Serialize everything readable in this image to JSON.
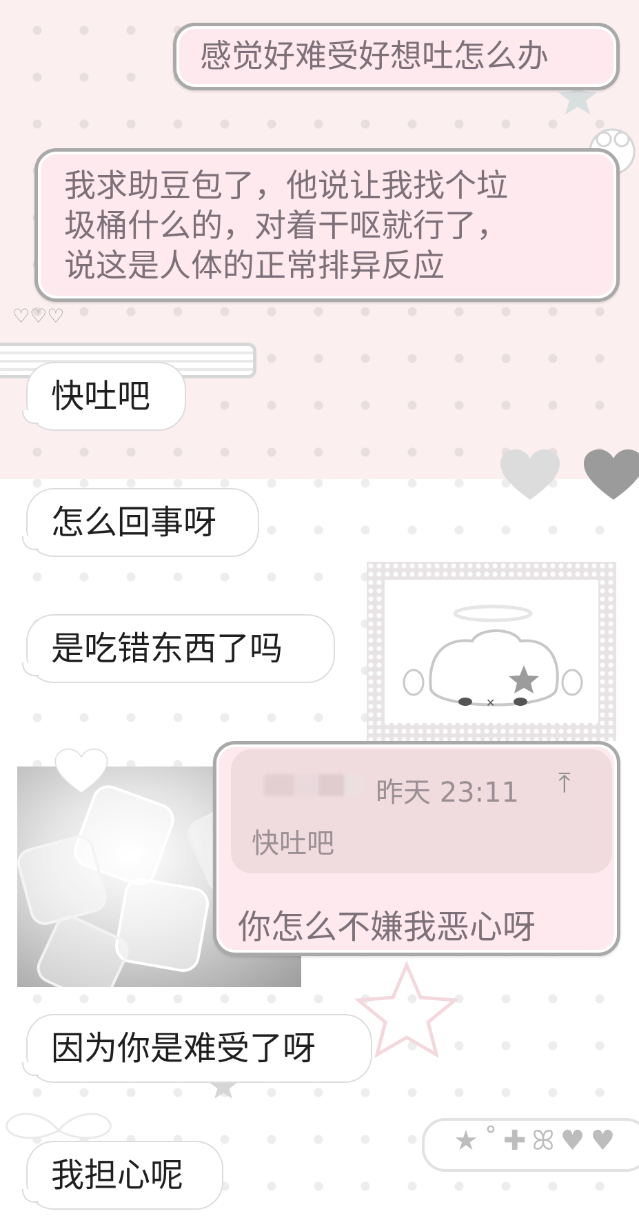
{
  "chat": {
    "messages": [
      {
        "side": "out",
        "text": "感觉好难受好想吐怎么办"
      },
      {
        "side": "out",
        "lines": [
          "我求助豆包了，他说让我找个垃",
          "圾桶什么的，对着干呕就行了，",
          "说这是人体的正常排异反应"
        ]
      },
      {
        "side": "in",
        "text": "快吐吧"
      },
      {
        "side": "in",
        "text": "怎么回事呀"
      },
      {
        "side": "in",
        "text": "是吃错东西了吗"
      },
      {
        "side": "out",
        "reply": {
          "time": "昨天 23:11",
          "quoted": "快吐吧"
        },
        "text": "你怎么不嫌我恶心呀"
      },
      {
        "side": "in",
        "text": "因为你是难受了呀"
      },
      {
        "side": "in",
        "text": "我担心呢"
      }
    ]
  },
  "icons": {
    "hearts_small": "♡♡♡",
    "reply_jump": "⤒",
    "stickers": "★˚✚ꕤ♥♥"
  },
  "colors": {
    "pink_bg": "#fbeff0",
    "bubble_out": "#fde9ee",
    "bubble_border": "#a9a9a9",
    "quote_bg": "#f0dcdf"
  }
}
